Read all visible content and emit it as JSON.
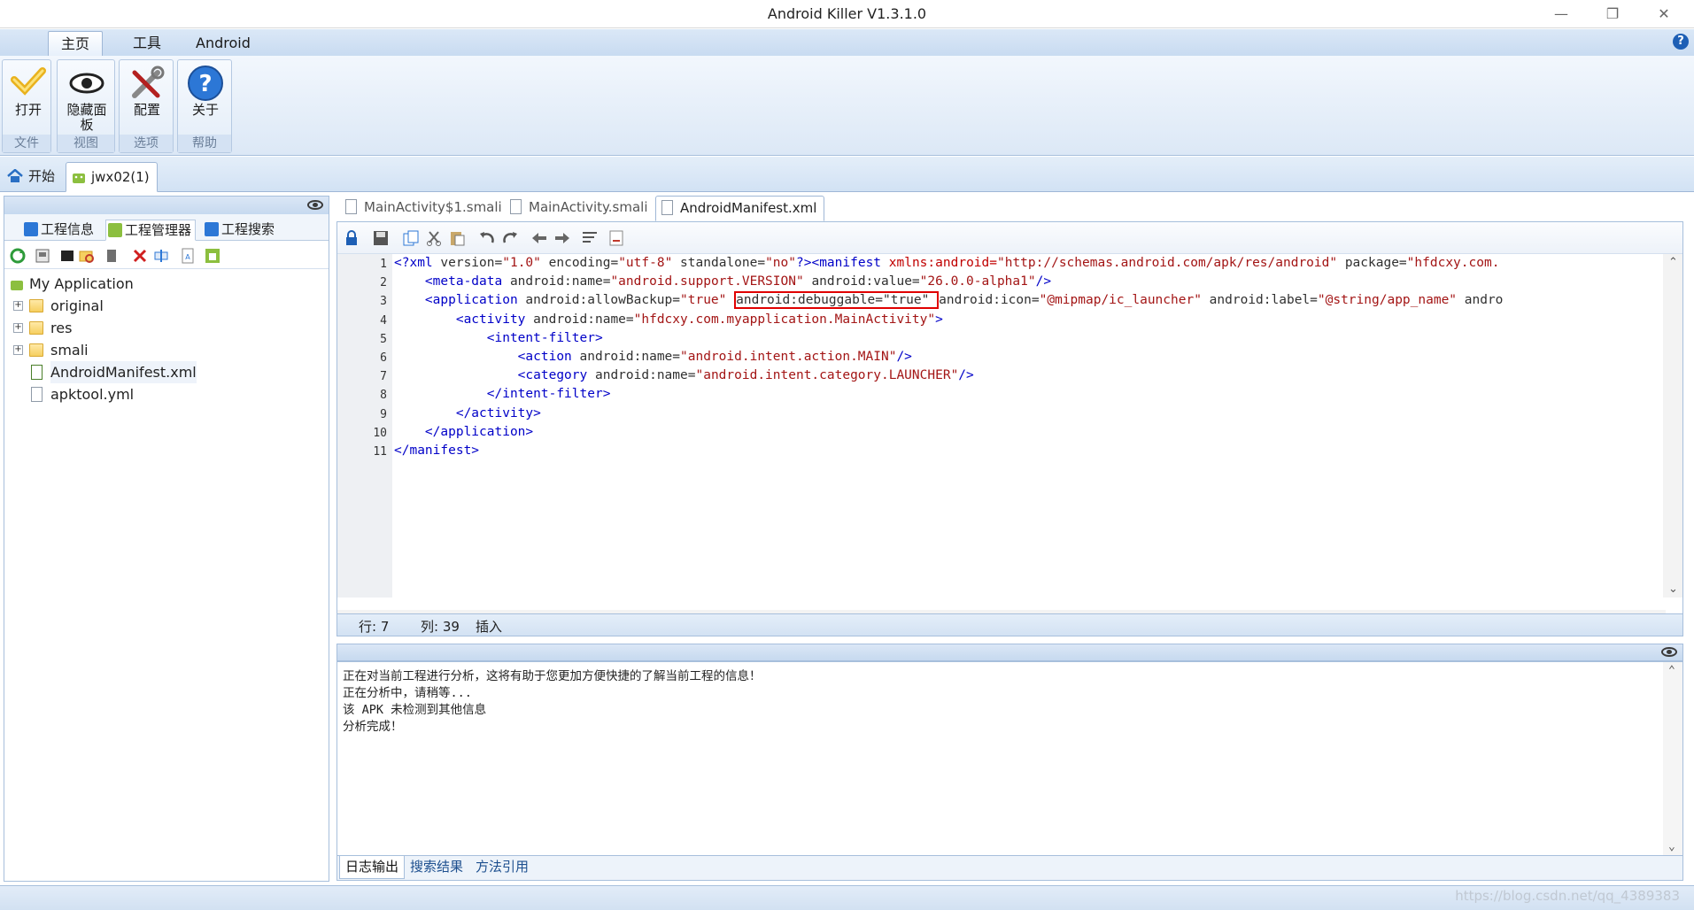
{
  "window": {
    "title": "Android Killer V1.3.1.0",
    "minimize": "—",
    "restore": "❐",
    "close": "✕"
  },
  "ribbon_tabs": [
    "主页",
    "工具",
    "Android"
  ],
  "ribbon_groups": [
    {
      "label": "文件",
      "button": "打开"
    },
    {
      "label": "视图",
      "button": "隐藏面板"
    },
    {
      "label": "选项",
      "button": "配置"
    },
    {
      "label": "帮助",
      "button": "关于"
    }
  ],
  "help_glyph": "?",
  "doc_tabs": [
    "开始",
    "jwx02(1)"
  ],
  "left_panel": {
    "tabs": [
      "工程信息",
      "工程管理器",
      "工程搜索"
    ],
    "tree": {
      "root": "My Application",
      "items": [
        "original",
        "res",
        "smali",
        "AndroidManifest.xml",
        "apktool.yml"
      ]
    }
  },
  "editor": {
    "tabs": [
      "MainActivity$1.smali",
      "MainActivity.smali",
      "AndroidManifest.xml"
    ],
    "line_numbers": [
      "1",
      "2",
      "3",
      "4",
      "5",
      "6",
      "7",
      "8",
      "9",
      "10",
      "11"
    ],
    "code_lines": [
      [
        [
          "tg",
          "<?xml "
        ],
        [
          "at",
          "version="
        ],
        [
          "vl",
          "\"1.0\" "
        ],
        [
          "at",
          "encoding="
        ],
        [
          "vl",
          "\"utf-8\" "
        ],
        [
          "at",
          "standalone="
        ],
        [
          "vl",
          "\"no\""
        ],
        [
          "tg",
          "?><manifest "
        ],
        [
          "ns",
          "xmlns:android="
        ],
        [
          "vl",
          "\"http://schemas.android.com/apk/res/android\" "
        ],
        [
          "at",
          "package="
        ],
        [
          "vl",
          "\"hfdcxy.com."
        ]
      ],
      [
        [
          "tg",
          "    <meta-data "
        ],
        [
          "at",
          "android:name="
        ],
        [
          "vl",
          "\"android.support.VERSION\" "
        ],
        [
          "at",
          "android:value="
        ],
        [
          "vl",
          "\"26.0.0-alpha1\""
        ],
        [
          "tg",
          "/>"
        ]
      ],
      [
        [
          "tg",
          "    <application "
        ],
        [
          "at",
          "android:allowBackup="
        ],
        [
          "vl",
          "\"true\" "
        ],
        [
          "hl",
          "android:debuggable=\"true\" "
        ],
        [
          "at",
          "android:icon="
        ],
        [
          "vl",
          "\"@mipmap/ic_launcher\" "
        ],
        [
          "at",
          "android:label="
        ],
        [
          "vl",
          "\"@string/app_name\" "
        ],
        [
          "at",
          "andro"
        ]
      ],
      [
        [
          "tg",
          "        <activity "
        ],
        [
          "at",
          "android:name="
        ],
        [
          "vl",
          "\"hfdcxy.com.myapplication.MainActivity\""
        ],
        [
          "tg",
          ">"
        ]
      ],
      [
        [
          "tg",
          "            <intent-filter>"
        ]
      ],
      [
        [
          "tg",
          "                <action "
        ],
        [
          "at",
          "android:name="
        ],
        [
          "vl",
          "\"android.intent.action.MAIN\""
        ],
        [
          "tg",
          "/>"
        ]
      ],
      [
        [
          "tg",
          "                <category "
        ],
        [
          "at",
          "android:name="
        ],
        [
          "vl",
          "\"android.intent.category.LAUNCHER\""
        ],
        [
          "tg",
          "/>"
        ]
      ],
      [
        [
          "tg",
          "            </intent-filter>"
        ]
      ],
      [
        [
          "tg",
          "        </activity>"
        ]
      ],
      [
        [
          "tg",
          "    </application>"
        ]
      ],
      [
        [
          "tg",
          "</manifest>"
        ]
      ]
    ],
    "status": {
      "row": "行: 7",
      "col": "列: 39",
      "mode": "插入"
    }
  },
  "log": {
    "lines": [
      "正在对当前工程进行分析，这将有助于您更加方便快捷的了解当前工程的信息！",
      "正在分析中，请稍等...",
      "该 APK 未检测到其他信息",
      "分析完成！"
    ],
    "tabs": [
      "日志输出",
      "搜索结果",
      "方法引用"
    ]
  },
  "watermark": "https://blog.csdn.net/qq_4389383",
  "colors": {
    "accent": "#1e5fb5",
    "highlight_box": "#e00000",
    "tag": "#0000c8",
    "value": "#a31515"
  }
}
